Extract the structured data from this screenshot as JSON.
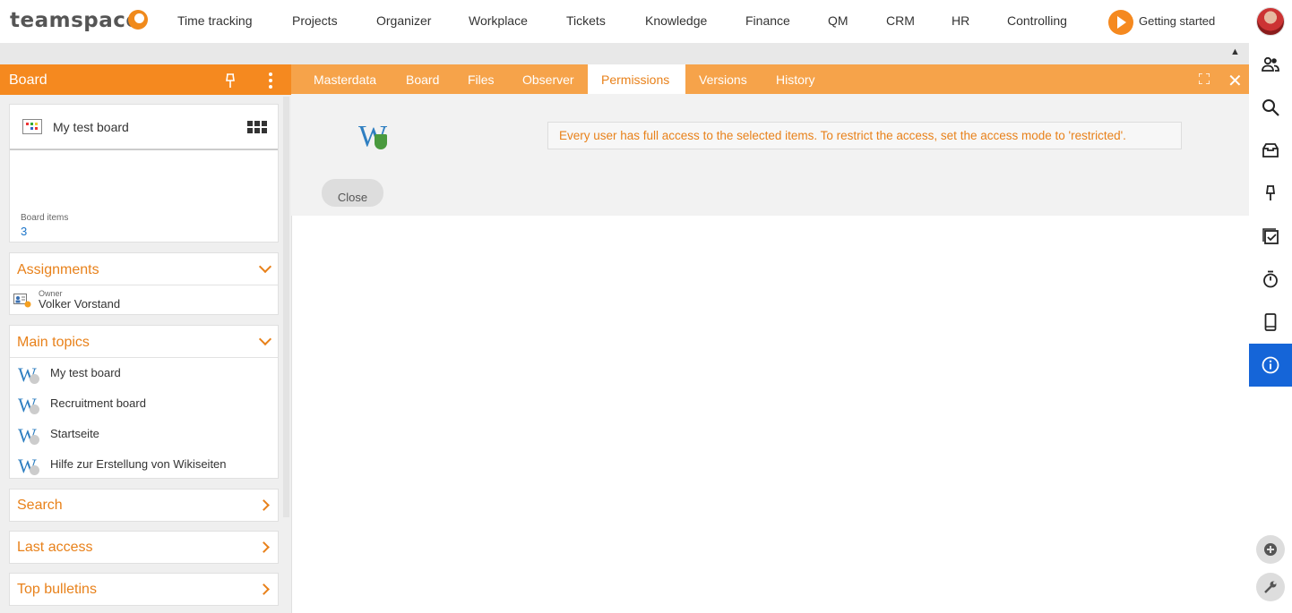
{
  "brand": {
    "name": "teamspace"
  },
  "topnav": {
    "items": [
      "Time tracking",
      "Projects",
      "Organizer",
      "Workplace",
      "Tickets",
      "Knowledge",
      "Finance",
      "QM",
      "CRM",
      "HR",
      "Controlling"
    ],
    "getting_started": "Getting started"
  },
  "left_panel": {
    "title": "Board",
    "board_card": {
      "name": "My test board",
      "items_label": "Board items",
      "items_count": "3"
    },
    "assignments": {
      "title": "Assignments",
      "owner_label": "Owner",
      "owner_name": "Volker Vorstand"
    },
    "main_topics": {
      "title": "Main topics",
      "items": [
        "My test board",
        "Recruitment board",
        "Startseite",
        "Hilfe zur Erstellung von Wikiseiten"
      ]
    },
    "search": {
      "title": "Search"
    },
    "last_access": {
      "title": "Last access"
    },
    "top_bulletins": {
      "title": "Top bulletins"
    }
  },
  "tabs": {
    "items": [
      "Masterdata",
      "Board",
      "Files",
      "Observer",
      "Permissions",
      "Versions",
      "History"
    ],
    "active": "Permissions"
  },
  "permissions": {
    "message": "Every user has full access to the selected items. To restrict the access, set the access mode to 'restricted'.",
    "close_label": "Close"
  },
  "icons": {
    "rail": [
      "people-icon",
      "search-icon",
      "inbox-icon",
      "pin-icon",
      "task-icon",
      "timer-icon",
      "mobile-icon",
      "info-icon"
    ],
    "bottom": [
      "add-icon",
      "wrench-icon"
    ]
  },
  "colors": {
    "accent": "#f5891f",
    "tab_bar": "#f6a34a",
    "link_blue": "#1a73c8",
    "rail_active": "#1565d8"
  }
}
